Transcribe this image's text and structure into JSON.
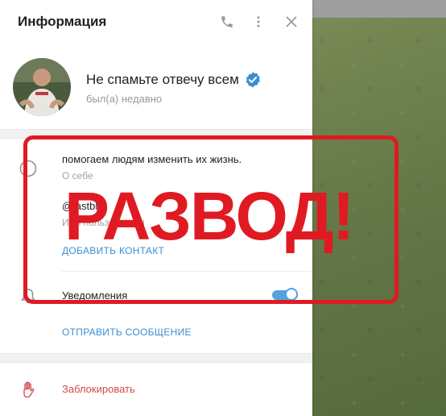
{
  "header": {
    "title": "Информация"
  },
  "profile": {
    "name": "Не спамьте отвечу всем",
    "status": "был(а) недавно",
    "verified": true
  },
  "info": {
    "about_text": "помогаем людям изменить их жизнь.",
    "about_label": "О себе",
    "username_text": "@fastblig",
    "username_label": "Имя пользователя",
    "add_contact": "ДОБАВИТЬ КОНТАКТ",
    "notifications_label": "Уведомления",
    "notifications_on": true,
    "send_message": "ОТПРАВИТЬ СООБЩЕНИЕ"
  },
  "actions": {
    "block_label": "Заблокировать"
  },
  "stamp": {
    "text": "РАЗВОД!"
  },
  "colors": {
    "accent": "#3a8fd1",
    "danger": "#d14b4b",
    "stamp": "#e01a22",
    "verified": "#3a8fd1"
  }
}
